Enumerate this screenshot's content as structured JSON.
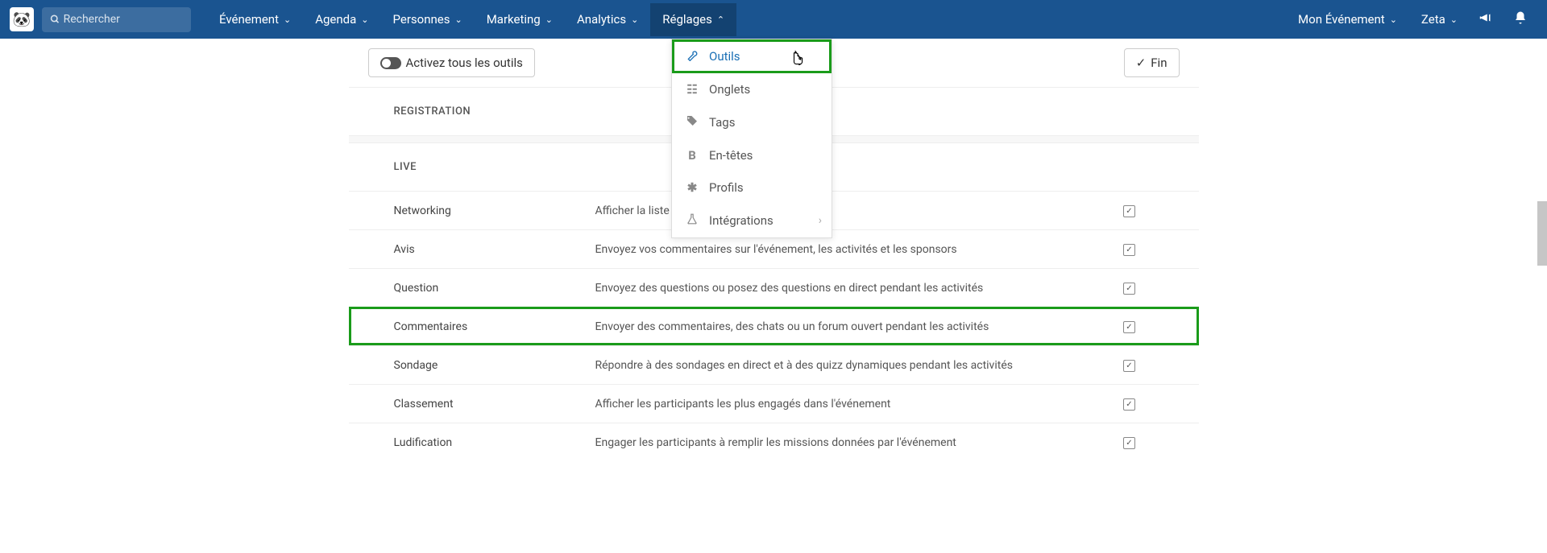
{
  "search": {
    "placeholder": "Rechercher"
  },
  "nav": {
    "evenement": "Événement",
    "agenda": "Agenda",
    "personnes": "Personnes",
    "marketing": "Marketing",
    "analytics": "Analytics",
    "reglages": "Réglages",
    "mon_evenement": "Mon Événement",
    "zeta": "Zeta"
  },
  "toolbar": {
    "activate_all": "Activez tous les outils",
    "fin": "Fin"
  },
  "dropdown": {
    "outils": "Outils",
    "onglets": "Onglets",
    "tags": "Tags",
    "entetes": "En-têtes",
    "profils": "Profils",
    "integrations": "Intégrations"
  },
  "sections": {
    "registration": "REGISTRATION",
    "live": "LIVE"
  },
  "tools": [
    {
      "name": "Networking",
      "desc": "Afficher la liste des participants à l'événement"
    },
    {
      "name": "Avis",
      "desc": "Envoyez vos commentaires sur l'événement, les activités et les sponsors"
    },
    {
      "name": "Question",
      "desc": "Envoyez des questions ou posez des questions en direct pendant les activités"
    },
    {
      "name": "Commentaires",
      "desc": "Envoyer des commentaires, des chats ou un forum ouvert pendant les activités"
    },
    {
      "name": "Sondage",
      "desc": "Répondre à des sondages en direct et à des quizz dynamiques pendant les activités"
    },
    {
      "name": "Classement",
      "desc": "Afficher les participants les plus engagés dans l'événement"
    },
    {
      "name": "Ludification",
      "desc": "Engager les participants à remplir les missions données par l'événement"
    }
  ]
}
